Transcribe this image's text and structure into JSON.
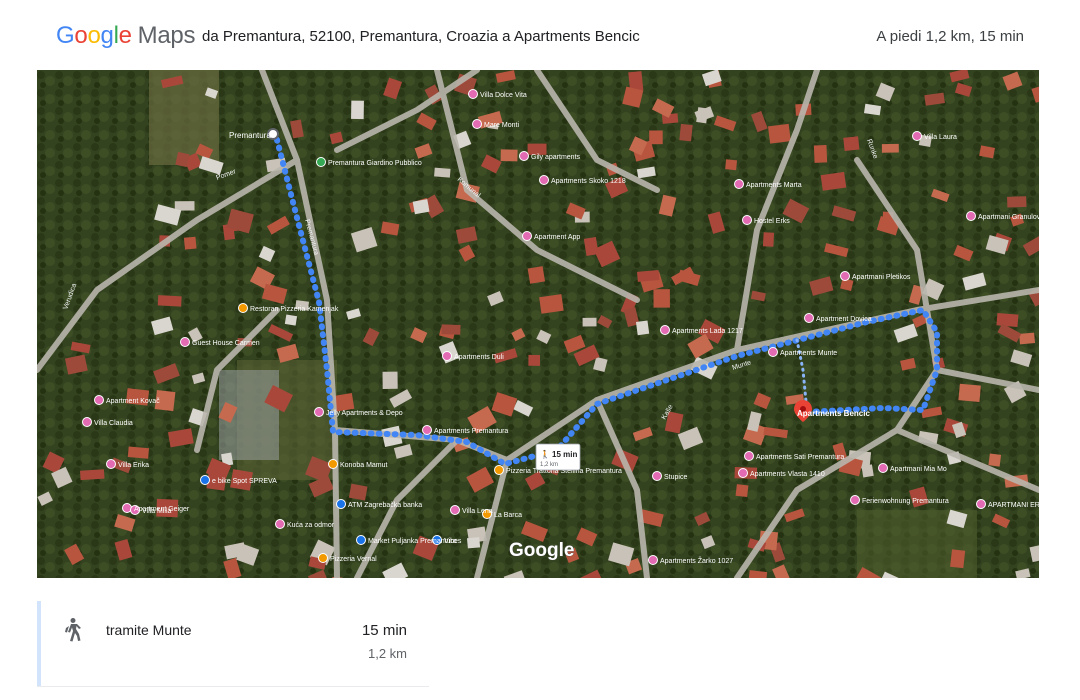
{
  "header": {
    "logo_google": "Google",
    "logo_maps": "Maps",
    "route_title": "da Premantura, 52100, Premantura, Croazia a Apartments Bencic",
    "summary": "A piedi 1,2 km, 15 min"
  },
  "map": {
    "watermark": "Google",
    "route_badge": {
      "time": "15 min",
      "distance": "1,2 km"
    },
    "origin_label": "Premantura",
    "destination_label": "Apartments Bencic",
    "street_labels": [
      "Premantura",
      "Munte",
      "Runke",
      "Kaše",
      "Verudica",
      "Pomer",
      "Komunal"
    ],
    "places": [
      {
        "label": "Villa Dolce Vita",
        "type": "hotel"
      },
      {
        "label": "Mare Monti",
        "type": "hotel"
      },
      {
        "label": "Gily apartments",
        "type": "hotel"
      },
      {
        "label": "Apartments Skoko 1218",
        "type": "hotel"
      },
      {
        "label": "Apartment App",
        "type": "hotel"
      },
      {
        "label": "Apartments Marta",
        "type": "hotel"
      },
      {
        "label": "Hostel Erks",
        "type": "hotel"
      },
      {
        "label": "Villa Laura",
        "type": "hotel"
      },
      {
        "label": "Apartmani Granulović",
        "type": "hotel"
      },
      {
        "label": "Apartmani Pletikos",
        "type": "hotel"
      },
      {
        "label": "Apartment Dovica",
        "type": "hotel"
      },
      {
        "label": "Apartments Munte",
        "type": "hotel"
      },
      {
        "label": "Apartments Lada 1217",
        "type": "hotel"
      },
      {
        "label": "Apartments Duli",
        "type": "hotel"
      },
      {
        "label": "Restoran Pizzeria Kamenjak",
        "type": "restaurant"
      },
      {
        "label": "Guest House Carmen",
        "type": "hotel"
      },
      {
        "label": "Apartment Kovač",
        "type": "hotel"
      },
      {
        "label": "Villa Claudia",
        "type": "hotel"
      },
      {
        "label": "Villa Erika",
        "type": "hotel"
      },
      {
        "label": "Apartment Geiger",
        "type": "hotel"
      },
      {
        "label": "e bike Spot SPREVA",
        "type": "shop"
      },
      {
        "label": "Villa Milla",
        "type": "hotel"
      },
      {
        "label": "Jelly Apartments & Depo",
        "type": "hotel"
      },
      {
        "label": "Apartments Premantura",
        "type": "hotel"
      },
      {
        "label": "Konoba Mamut",
        "type": "restaurant"
      },
      {
        "label": "Pizzeria Trattoria Stellina Premantura",
        "type": "restaurant"
      },
      {
        "label": "ATM Zagrebačka banka",
        "type": "atm"
      },
      {
        "label": "Villa Lena",
        "type": "hotel"
      },
      {
        "label": "La Barca",
        "type": "restaurant"
      },
      {
        "label": "Kuća za odmor",
        "type": "hotel"
      },
      {
        "label": "Vibes",
        "type": "shop"
      },
      {
        "label": "Pizzeria Vernal",
        "type": "restaurant"
      },
      {
        "label": "Market Puljanka Premantura",
        "type": "shop"
      },
      {
        "label": "Apartments Sati Premantura",
        "type": "hotel"
      },
      {
        "label": "Apartments Vlasta 1410",
        "type": "hotel"
      },
      {
        "label": "Stupice",
        "type": "hotel"
      },
      {
        "label": "Apartmani Mia Mo",
        "type": "hotel"
      },
      {
        "label": "Ferienwohnung Premantura",
        "type": "hotel"
      },
      {
        "label": "Apartments Žarko 1027",
        "type": "hotel"
      },
      {
        "label": "APARTMANI ERCAN",
        "type": "hotel"
      },
      {
        "label": "Premantura Giardino Pubblico",
        "type": "park"
      }
    ]
  },
  "step": {
    "icon": "walking-person-icon",
    "via": "tramite Munte",
    "duration": "15 min",
    "distance": "1,2 km"
  },
  "colors": {
    "route": "#4285f4",
    "hotel_pin": "#e26bb4",
    "restaurant_pin": "#f29900",
    "destination_pin": "#ea4335",
    "panel_bar": "#d2e3fc"
  }
}
